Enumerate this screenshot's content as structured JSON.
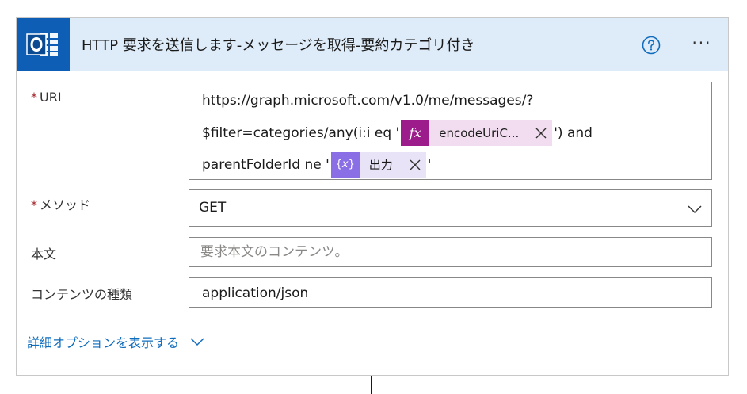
{
  "header": {
    "title": "HTTP 要求を送信します-メッセージを取得-要約カテゴリ付き",
    "more_label": "···",
    "brand_color": "#0f5eb5"
  },
  "uri": {
    "label": "URI",
    "required_mark": "*",
    "line1": "https://graph.microsoft.com/v1.0/me/messages/?",
    "line2_prefix": "$filter=categories/any(i:i eq '",
    "token_expression": "encodeUriC...",
    "line2_suffix": "')  and",
    "line3_prefix": "parentFolderId ne '",
    "token_variable": "出力",
    "line3_suffix": "'"
  },
  "method": {
    "label": "メソッド",
    "required_mark": "*",
    "value": "GET"
  },
  "body": {
    "label": "本文",
    "placeholder": "要求本文のコンテンツ。"
  },
  "content_type": {
    "label": "コンテンツの種類",
    "value": "application/json"
  },
  "advanced": {
    "label": "詳細オプションを表示する"
  }
}
